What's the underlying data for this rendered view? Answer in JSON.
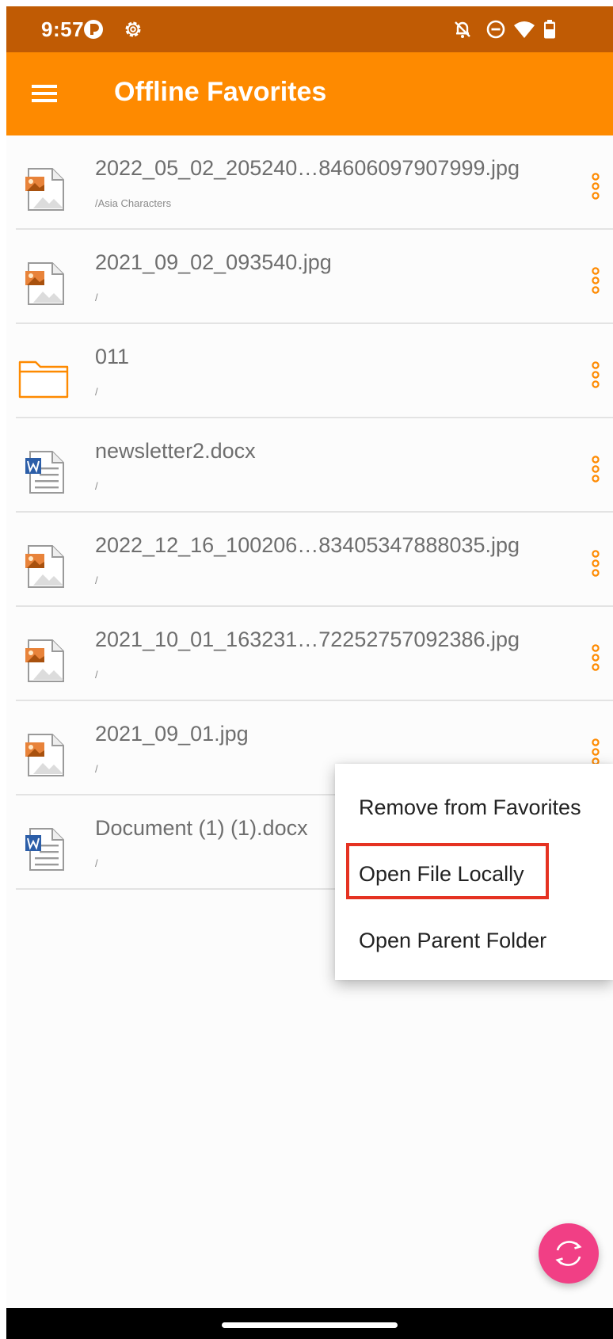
{
  "status_bar": {
    "time": "9:57",
    "icons": [
      "app-notification-icon",
      "settings-icon",
      "notifications-off-icon",
      "do-not-disturb-icon",
      "wifi-icon",
      "battery-icon"
    ]
  },
  "app_bar": {
    "menu_icon": "hamburger-menu-icon",
    "title": "Offline Favorites"
  },
  "files": [
    {
      "name": "2022_05_02_205240…84606097907999.jpg",
      "path": "/Asia Characters",
      "type": "image"
    },
    {
      "name": "2021_09_02_093540.jpg",
      "path": "/",
      "type": "image"
    },
    {
      "name": "011",
      "path": "/",
      "type": "folder"
    },
    {
      "name": "newsletter2.docx",
      "path": "/",
      "type": "word"
    },
    {
      "name": "2022_12_16_100206…83405347888035.jpg",
      "path": "/",
      "type": "image"
    },
    {
      "name": "2021_10_01_163231…72252757092386.jpg",
      "path": "/",
      "type": "image"
    },
    {
      "name": "2021_09_01.jpg",
      "path": "/",
      "type": "image"
    },
    {
      "name": "Document (1) (1).docx",
      "path": "/",
      "type": "word"
    }
  ],
  "popup_menu": {
    "items": [
      "Remove from Favorites",
      "Open File Locally",
      "Open Parent Folder"
    ],
    "highlighted": "Open File Locally"
  },
  "fab": {
    "icon": "sync-icon"
  },
  "colors": {
    "status_bar": "#c05b04",
    "app_bar": "#fe8a00",
    "accent": "#fe8a00",
    "fab": "#f13f85",
    "highlight": "#e53222"
  }
}
